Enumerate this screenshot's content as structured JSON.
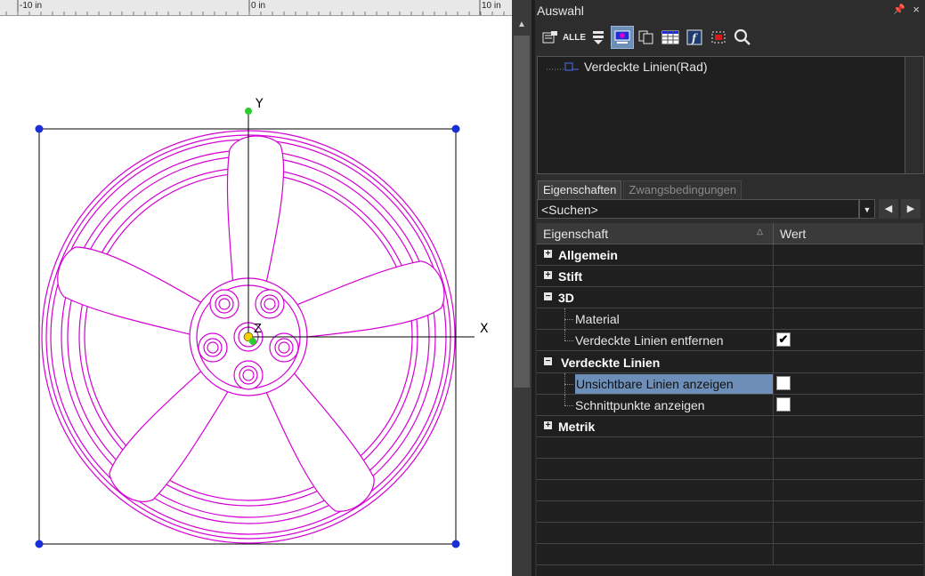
{
  "ruler": {
    "labels": [
      "-10 in",
      "0 in",
      "10 in"
    ]
  },
  "drawing": {
    "axis_labels": {
      "x": "X",
      "y": "Y",
      "z": "Z"
    }
  },
  "panel": {
    "title": "Auswahl",
    "pin_icon": "pin-icon",
    "close_icon": "close-icon",
    "toolbar": [
      {
        "name": "properties-icon",
        "glyph": "▤"
      },
      {
        "name": "select-all-icon",
        "glyph": "ALLE"
      },
      {
        "name": "filter-icon",
        "glyph": "⇩"
      },
      {
        "name": "display-icon",
        "glyph": "▣"
      },
      {
        "name": "copy-icon",
        "glyph": "⧉"
      },
      {
        "name": "table-icon",
        "glyph": "▦"
      },
      {
        "name": "function-icon",
        "glyph": "f"
      },
      {
        "name": "frame-select-icon",
        "glyph": "⊡"
      },
      {
        "name": "search-icon",
        "glyph": "⌕"
      }
    ],
    "tree_item": "Verdeckte Linien(Rad)",
    "tabs": {
      "properties": "Eigenschaften",
      "constraints": "Zwangsbedingungen"
    },
    "search": {
      "placeholder": "<Suchen>"
    },
    "grid": {
      "header_property": "Eigenschaft",
      "header_value": "Wert",
      "rows": [
        {
          "kind": "category",
          "label": "Allgemein",
          "expanded": false
        },
        {
          "kind": "category",
          "label": "Stift",
          "expanded": false
        },
        {
          "kind": "category",
          "label": "3D",
          "expanded": true
        },
        {
          "kind": "child",
          "label": "Material"
        },
        {
          "kind": "child",
          "label": "Verdeckte Linien entfernen",
          "checked": true
        },
        {
          "kind": "category",
          "label": "Verdeckte Linien",
          "expanded": true
        },
        {
          "kind": "child",
          "label": "Unsichtbare Linien anzeigen",
          "checked": false,
          "selected": true
        },
        {
          "kind": "child",
          "label": "Schnittpunkte anzeigen",
          "checked": false
        },
        {
          "kind": "category",
          "label": "Metrik",
          "expanded": false
        }
      ]
    }
  },
  "colors": {
    "wheel": "#d400d4",
    "selection": "#6d8fb7",
    "handle": "#1a2fd6",
    "origin": "#2ecc2e"
  }
}
